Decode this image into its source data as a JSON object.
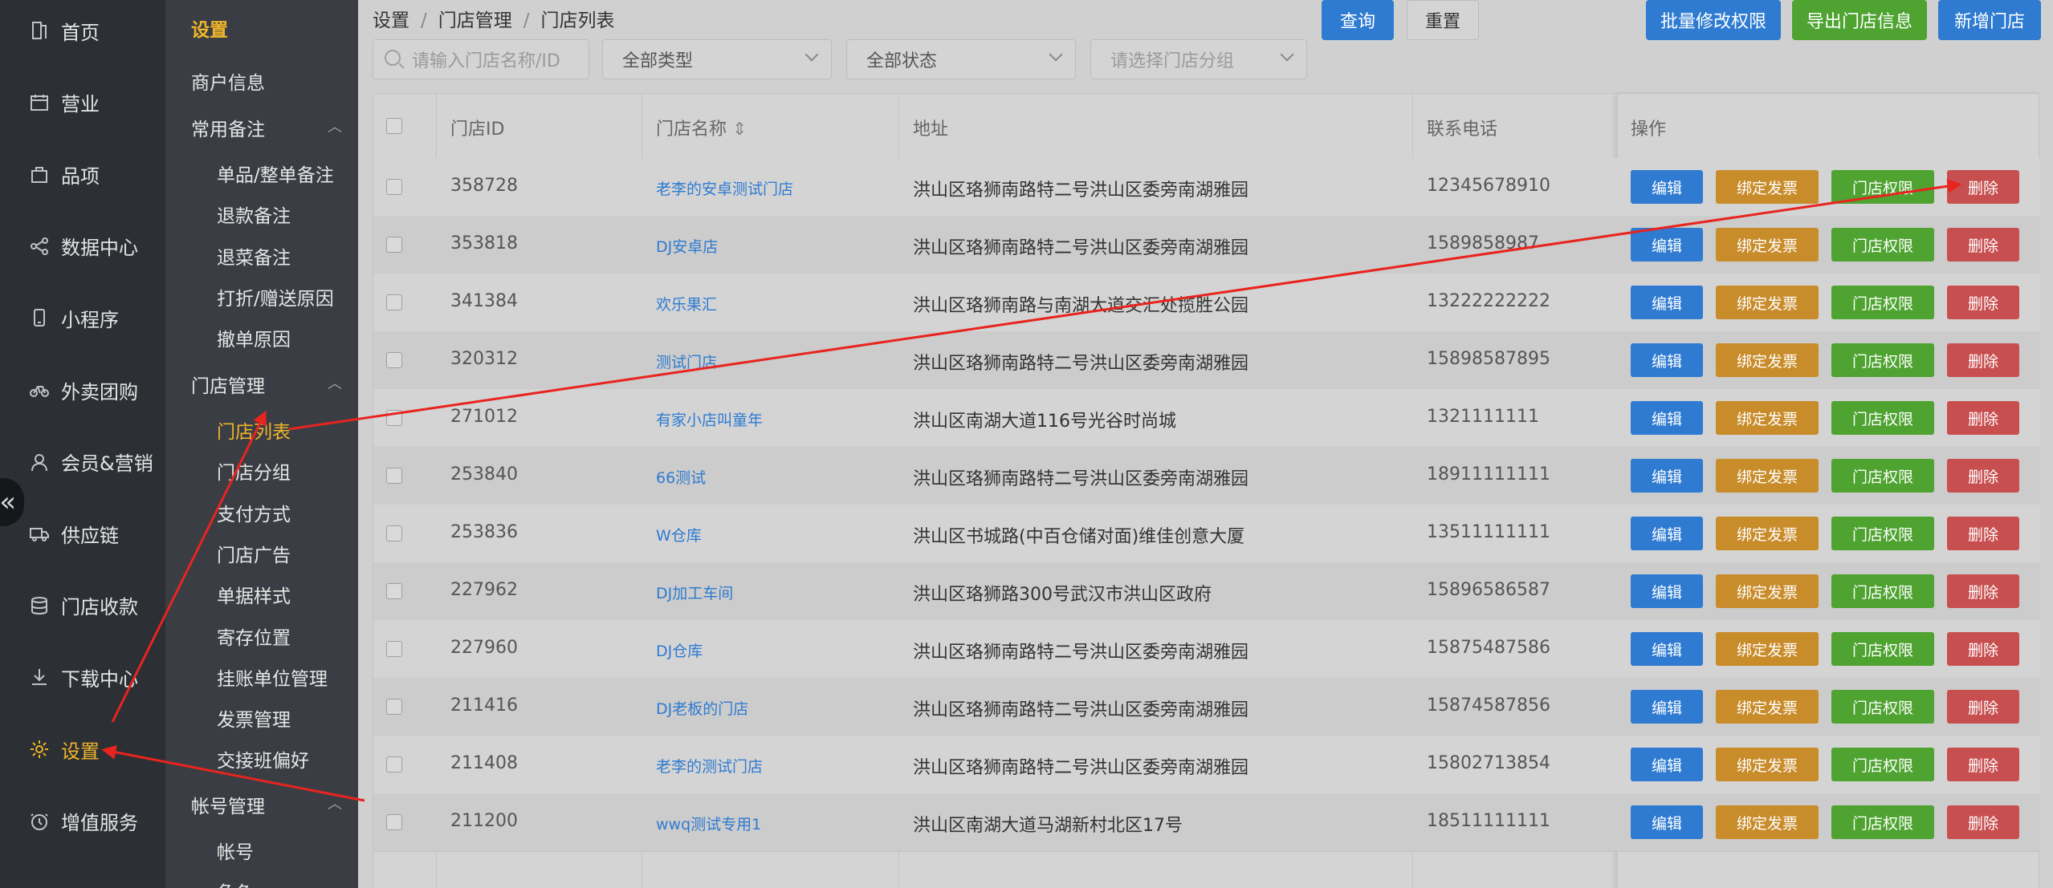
{
  "nav_main": [
    {
      "label": "首页",
      "icon": "home-icon"
    },
    {
      "label": "营业",
      "icon": "calendar-icon"
    },
    {
      "label": "品项",
      "icon": "bag-icon"
    },
    {
      "label": "数据中心",
      "icon": "share-icon"
    },
    {
      "label": "小程序",
      "icon": "mobile-icon"
    },
    {
      "label": "外卖团购",
      "icon": "bike-icon"
    },
    {
      "label": "会员&营销",
      "icon": "user-icon"
    },
    {
      "label": "供应链",
      "icon": "truck-icon"
    },
    {
      "label": "门店收款",
      "icon": "database-icon"
    },
    {
      "label": "下载中心",
      "icon": "download-icon"
    },
    {
      "label": "设置",
      "icon": "gear-icon"
    },
    {
      "label": "增值服务",
      "icon": "clock-icon"
    }
  ],
  "collapse_label": "«",
  "nav_sub": {
    "title": "设置",
    "merchant": "商户信息",
    "groups": [
      {
        "label": "常用备注",
        "items": [
          "单品/整单备注",
          "退款备注",
          "退菜备注",
          "打折/赠送原因",
          "撤单原因"
        ]
      },
      {
        "label": "门店管理",
        "items": [
          "门店列表",
          "门店分组",
          "支付方式",
          "门店广告",
          "单据样式",
          "寄存位置",
          "挂账单位管理",
          "发票管理",
          "交接班偏好"
        ]
      },
      {
        "label": "帐号管理",
        "items": [
          "帐号",
          "角色"
        ]
      }
    ]
  },
  "breadcrumb": [
    "设置",
    "门店管理",
    "门店列表"
  ],
  "breadcrumb_sep": "/",
  "top_icons": {
    "refresh": "⟳",
    "back": "←"
  },
  "filters": {
    "search_placeholder": "请输入门店名称/ID",
    "type": "全部类型",
    "status": "全部状态",
    "group_placeholder": "请选择门店分组"
  },
  "buttons": {
    "query": "查询",
    "reset": "重置",
    "batch_perm": "批量修改权限",
    "export": "导出门店信息",
    "add": "新增门店"
  },
  "table": {
    "headers": {
      "id": "门店ID",
      "name": "门店名称",
      "address": "地址",
      "phone": "联系电话",
      "ops": "操作"
    },
    "sort_glyph": "⇕",
    "ops": {
      "edit": "编辑",
      "invoice": "绑定发票",
      "perm": "门店权限",
      "del": "删除"
    },
    "rows": [
      {
        "id": "358728",
        "name": "老李的安卓测试门店",
        "address": "洪山区珞狮南路特二号洪山区委旁南湖雅园",
        "phone": "12345678910"
      },
      {
        "id": "353818",
        "name": "DJ安卓店",
        "address": "洪山区珞狮南路特二号洪山区委旁南湖雅园",
        "phone": "1589858987"
      },
      {
        "id": "341384",
        "name": "欢乐果汇",
        "address": "洪山区珞狮南路与南湖大道交汇处揽胜公园",
        "phone": "13222222222"
      },
      {
        "id": "320312",
        "name": "测试门店",
        "address": "洪山区珞狮南路特二号洪山区委旁南湖雅园",
        "phone": "15898587895"
      },
      {
        "id": "271012",
        "name": "有家小店叫童年",
        "address": "洪山区南湖大道116号光谷时尚城",
        "phone": "1321111111"
      },
      {
        "id": "253840",
        "name": "66测试",
        "address": "洪山区珞狮南路特二号洪山区委旁南湖雅园",
        "phone": "18911111111"
      },
      {
        "id": "253836",
        "name": "W仓库",
        "address": "洪山区书城路(中百仓储对面)维佳创意大厦",
        "phone": "13511111111"
      },
      {
        "id": "227962",
        "name": "DJ加工车间",
        "address": "洪山区珞狮路300号武汉市洪山区政府",
        "phone": "15896586587"
      },
      {
        "id": "227960",
        "name": "DJ仓库",
        "address": "洪山区珞狮南路特二号洪山区委旁南湖雅园",
        "phone": "15875487586"
      },
      {
        "id": "211416",
        "name": "DJ老板的门店",
        "address": "洪山区珞狮南路特二号洪山区委旁南湖雅园",
        "phone": "15874587856"
      },
      {
        "id": "211408",
        "name": "老李的测试门店",
        "address": "洪山区珞狮南路特二号洪山区委旁南湖雅园",
        "phone": "15802713854"
      },
      {
        "id": "211200",
        "name": "wwq测试专用1",
        "address": "洪山区南湖大道马湖新村北区17号",
        "phone": "18511111111"
      }
    ]
  },
  "colors": {
    "accent": "#f0b52a",
    "primary": "#2e7bd1",
    "success": "#4ea331",
    "warning": "#c98c2a",
    "danger": "#c84f4f",
    "annotation": "#e8241f"
  }
}
